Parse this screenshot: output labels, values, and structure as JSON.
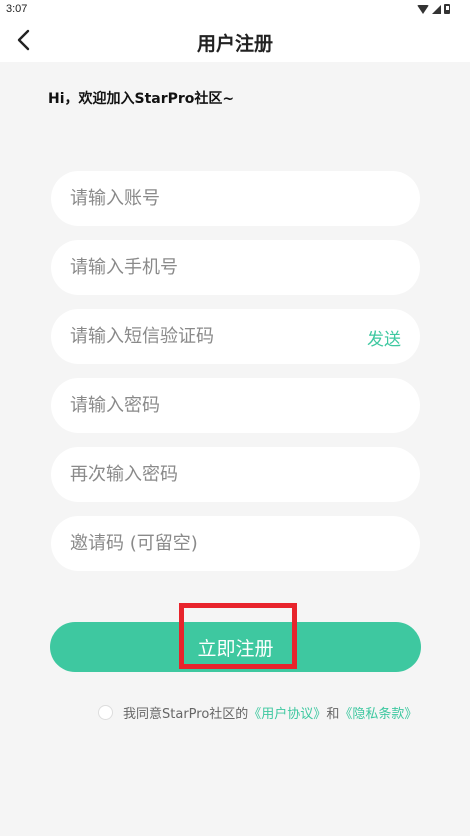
{
  "status_bar": {
    "time": "3:07"
  },
  "header": {
    "title": "用户注册"
  },
  "welcome_text": "Hi，欢迎加入StarPro社区~",
  "form": {
    "account_placeholder": "请输入账号",
    "phone_placeholder": "请输入手机号",
    "sms_code_placeholder": "请输入短信验证码",
    "send_label": "发送",
    "password_placeholder": "请输入密码",
    "confirm_password_placeholder": "再次输入密码",
    "invite_code_placeholder": "邀请码 (可留空)"
  },
  "register_button": "立即注册",
  "agreement": {
    "prefix": "我同意StarPro社区的",
    "user_agreement": "《用户协议》",
    "and": "和",
    "privacy_policy": "《隐私条款》"
  },
  "colors": {
    "accent": "#3ec8a0",
    "highlight": "#e8242c",
    "background": "#f5f5f5"
  }
}
